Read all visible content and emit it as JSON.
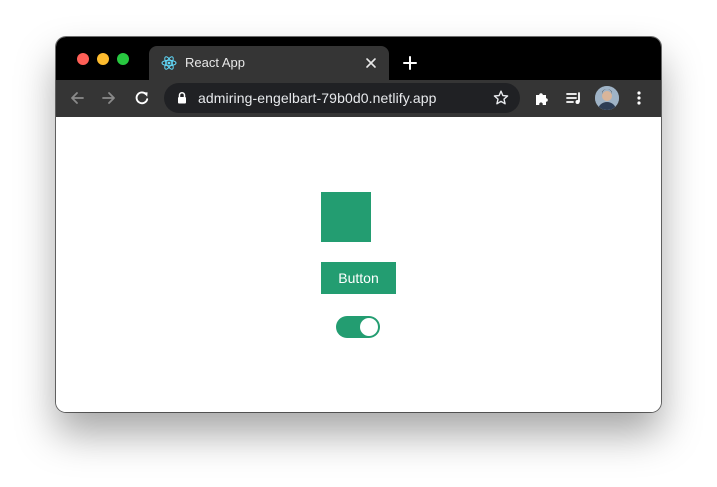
{
  "browser": {
    "tab": {
      "title": "React App",
      "favicon": "react-logo-icon"
    },
    "toolbar": {
      "back_icon": "arrow-left-icon",
      "forward_icon": "arrow-right-icon",
      "reload_icon": "reload-icon",
      "url": "admiring-engelbart-79b0d0.netlify.app",
      "bookmark_icon": "star-icon",
      "extensions_icon": "puzzle-icon",
      "media_icon": "playlist-icon",
      "menu_icon": "kebab-menu-icon"
    },
    "colors": {
      "titlebar": "#000000",
      "tab": "#353535",
      "omnibox": "#202124"
    }
  },
  "app": {
    "accent_color": "#239d71",
    "button_label": "Button",
    "toggle_on": true
  }
}
